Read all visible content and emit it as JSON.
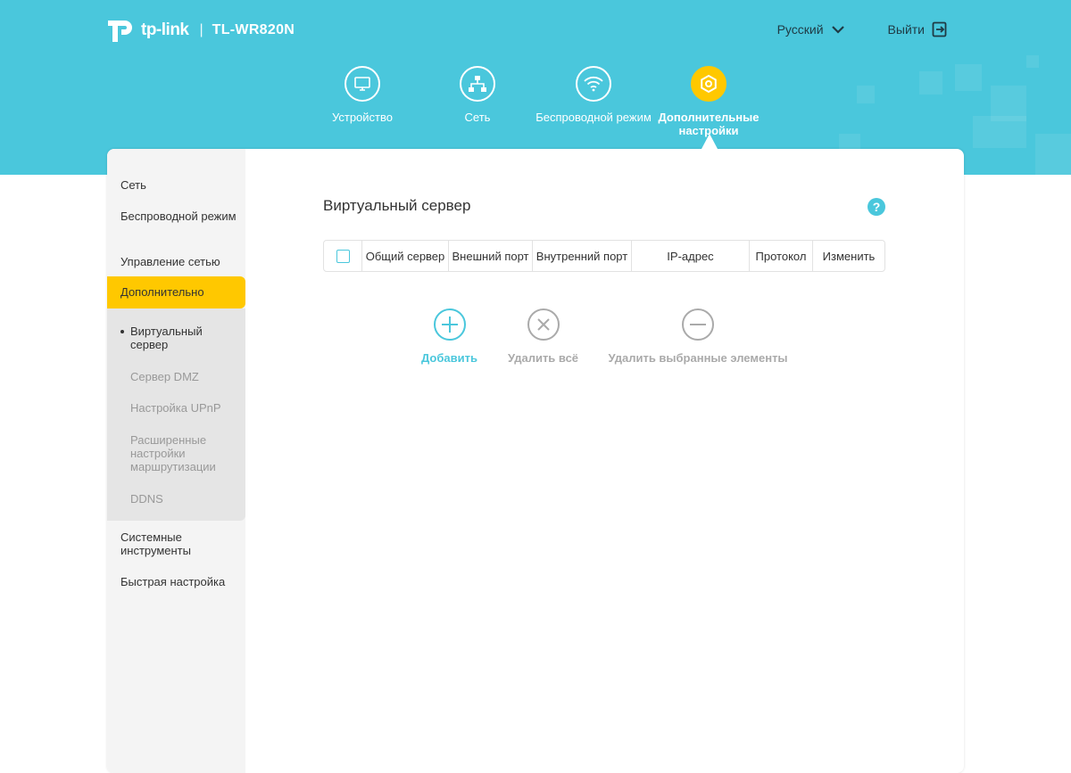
{
  "header": {
    "brand": "tp-link",
    "separator": "|",
    "model": "TL-WR820N",
    "language": "Русский",
    "logout": "Выйти"
  },
  "nav": [
    {
      "label": "Устройство",
      "icon": "monitor-icon"
    },
    {
      "label": "Сеть",
      "icon": "network-icon"
    },
    {
      "label": "Беспроводной режим",
      "icon": "wifi-icon"
    },
    {
      "label": "Дополнительные настройки",
      "icon": "gear-icon",
      "active": true
    }
  ],
  "sidebar": {
    "items": [
      "Сеть",
      "Беспроводной режим",
      "Управление сетью",
      "Дополнительно",
      "Системные инструменты",
      "Быстрая настройка"
    ],
    "sub_items": [
      "Виртуальный сервер",
      "Сервер DMZ",
      "Настройка UPnP",
      "Расширенные настройки маршрутизации",
      "DDNS"
    ],
    "active_item": "Дополнительно",
    "current_sub_item": "Виртуальный сервер"
  },
  "main": {
    "title": "Виртуальный сервер",
    "help": "?",
    "table_headers": [
      "Общий сервер",
      "Внешний порт",
      "Внутренний порт",
      "IP-адрес",
      "Протокол",
      "Изменить"
    ],
    "actions": {
      "add": "Добавить",
      "delete_all": "Удалить всё",
      "delete_selected": "Удалить выбранные элементы"
    }
  },
  "colors": {
    "header_bg": "#4ac7dc",
    "accent": "#ffc800",
    "primary": "#4ac7dc"
  }
}
